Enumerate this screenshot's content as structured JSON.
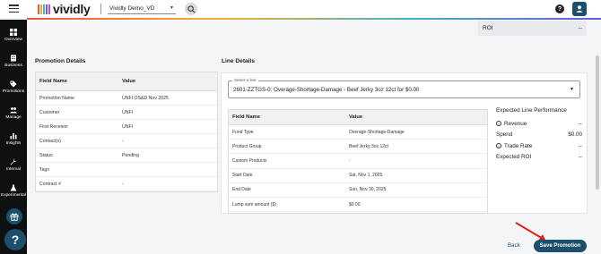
{
  "app": {
    "logo_text": "vividly",
    "workspace": "Vividly Demo_VD",
    "accent_gradient": [
      "#e9573f",
      "#f2b134",
      "#44b3c2",
      "#6c5bd6"
    ]
  },
  "sidebar": {
    "items": [
      {
        "label": "Overview",
        "icon": "grid-icon"
      },
      {
        "label": "Business",
        "icon": "building-icon"
      },
      {
        "label": "Promotions",
        "icon": "tag-icon"
      },
      {
        "label": "Manage",
        "icon": "people-icon"
      },
      {
        "label": "Insights",
        "icon": "bar-chart-icon"
      },
      {
        "label": "Internal",
        "icon": "wrench-icon"
      },
      {
        "label": "Experimental",
        "icon": "flask-icon"
      }
    ]
  },
  "roi_card": {
    "label": "ROI",
    "value": "--"
  },
  "promotion_details": {
    "title": "Promotion Details",
    "headers": [
      "Field Name",
      "Value"
    ],
    "rows": [
      [
        "Promotion Name",
        "UNFI OS&D Nov 2025"
      ],
      [
        "Customer",
        "UNFI"
      ],
      [
        "First Receiver",
        "UNFI"
      ],
      [
        "Contact(s)",
        "-"
      ],
      [
        "Status",
        "Pending"
      ],
      [
        "Tags",
        ""
      ],
      [
        "Contract #",
        "-"
      ]
    ]
  },
  "line_details": {
    "title": "Line Details",
    "select_legend": "Select a line",
    "selected_line": "2601-ZZTGS-0: Overage-Shortage-Damage - Beef Jerky 3oz 12ct for $0.00",
    "headers": [
      "Field Name",
      "Value"
    ],
    "rows": [
      [
        "Fund Type",
        "Overage-Shortage-Damage"
      ],
      [
        "Product Group",
        "Beef Jerky 3oz 12ct"
      ],
      [
        "Custom Products",
        "-"
      ],
      [
        "Start Date",
        "Sat, Nov 1, 2025"
      ],
      [
        "End Date",
        "Sun, Nov 30, 2025"
      ],
      [
        "Lump sum amount ($)",
        "$0.00"
      ]
    ]
  },
  "expected": {
    "title": "Expected Line Performance",
    "rows": [
      {
        "label": "Revenue",
        "value": "--",
        "info": true
      },
      {
        "label": "Spend",
        "value": "$0.00",
        "info": false
      },
      {
        "label": "Trade Rate",
        "value": "--",
        "info": true
      },
      {
        "label": "Expected ROI",
        "value": "--",
        "info": false
      }
    ]
  },
  "actions": {
    "back": "Back",
    "save": "Save Promotion"
  }
}
